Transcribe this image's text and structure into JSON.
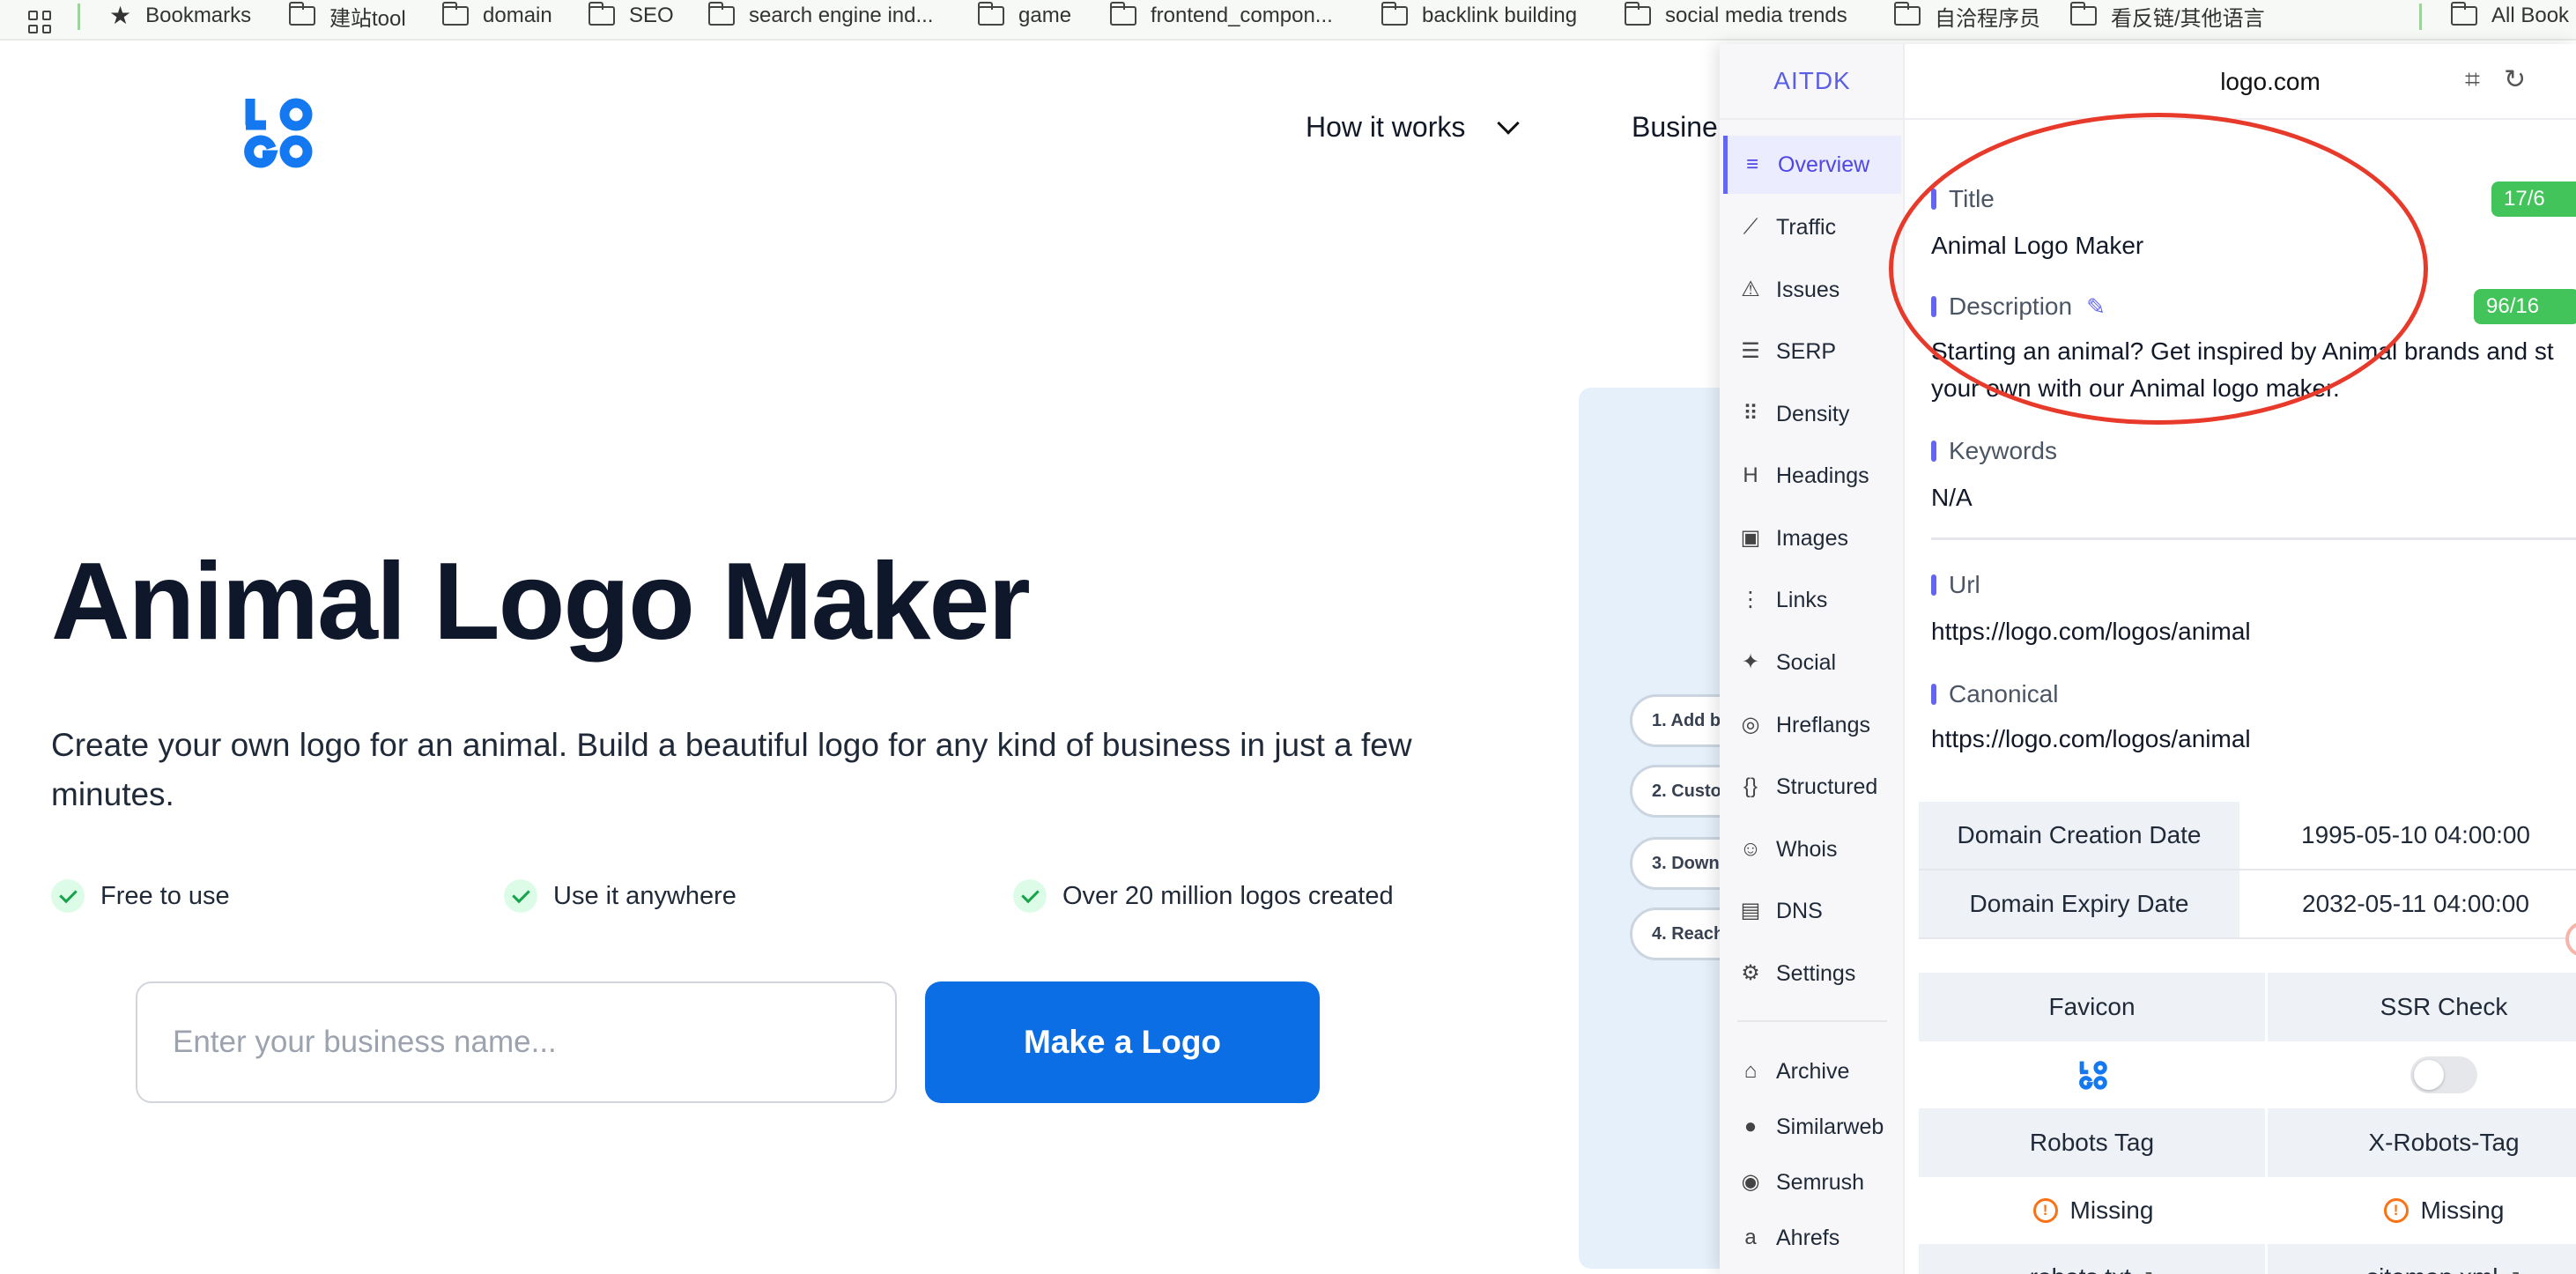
{
  "bookmarks": {
    "items": [
      {
        "label": "Bookmarks",
        "icon": "star-icon"
      },
      {
        "label": "建站tool",
        "icon": "folder-icon"
      },
      {
        "label": "domain",
        "icon": "folder-icon"
      },
      {
        "label": "SEO",
        "icon": "folder-icon"
      },
      {
        "label": "search engine ind...",
        "icon": "folder-icon"
      },
      {
        "label": "game",
        "icon": "folder-icon"
      },
      {
        "label": "frontend_compon...",
        "icon": "folder-icon"
      },
      {
        "label": "backlink building",
        "icon": "folder-icon"
      },
      {
        "label": "social media trends",
        "icon": "folder-icon"
      },
      {
        "label": "自洽程序员",
        "icon": "folder-icon"
      },
      {
        "label": "看反链/其他语言",
        "icon": "folder-icon"
      }
    ],
    "all_label": "All Book"
  },
  "site": {
    "nav": {
      "how_it_works": "How it works",
      "business": "Busine"
    },
    "hero": {
      "title": "Animal Logo Maker",
      "subtitle": "Create your own logo for an animal. Build a beautiful logo for any kind of business in just a few minutes."
    },
    "features": [
      "Free to use",
      "Use it anywhere",
      "Over 20 million logos created"
    ],
    "input_placeholder": "Enter your business name...",
    "cta": "Make a Logo",
    "steps": [
      "1. Add b",
      "2. Custo",
      "3. Downl",
      "4. Reach"
    ]
  },
  "panel": {
    "brand": "AITDK",
    "domain": "logo.com",
    "sidebar": [
      {
        "label": "Overview",
        "icon": "overview-icon",
        "active": true
      },
      {
        "label": "Traffic",
        "icon": "traffic-icon"
      },
      {
        "label": "Issues",
        "icon": "warning-icon"
      },
      {
        "label": "SERP",
        "icon": "serp-icon"
      },
      {
        "label": "Density",
        "icon": "density-icon"
      },
      {
        "label": "Headings",
        "icon": "heading-icon"
      },
      {
        "label": "Images",
        "icon": "image-icon"
      },
      {
        "label": "Links",
        "icon": "links-icon"
      },
      {
        "label": "Social",
        "icon": "twitter-icon"
      },
      {
        "label": "Hreflangs",
        "icon": "globe-icon"
      },
      {
        "label": "Structured",
        "icon": "braces-icon"
      },
      {
        "label": "Whois",
        "icon": "user-search-icon"
      },
      {
        "label": "DNS",
        "icon": "server-icon"
      },
      {
        "label": "Settings",
        "icon": "gear-icon"
      }
    ],
    "sidebar_extra": [
      {
        "label": "Archive",
        "icon": "archive-icon"
      },
      {
        "label": "Similarweb",
        "icon": "similarweb-icon"
      },
      {
        "label": "Semrush",
        "icon": "semrush-icon"
      },
      {
        "label": "Ahrefs",
        "icon": "amazon-icon"
      }
    ],
    "overview": {
      "title_label": "Title",
      "title_count": "17/6",
      "title_value": "Animal Logo Maker",
      "description_label": "Description",
      "description_count": "96/16",
      "description_line1": "Starting an animal? Get inspired by Animal brands and st",
      "description_line2": "your own with our Animal logo maker.",
      "keywords_label": "Keywords",
      "keywords_value": "N/A",
      "url_label": "Url",
      "url_value": "https://logo.com/logos/animal",
      "canonical_label": "Canonical",
      "canonical_value": "https://logo.com/logos/animal"
    },
    "domain_info": {
      "creation_label": "Domain Creation Date",
      "creation_value": "1995-05-10 04:00:00",
      "expiry_label": "Domain Expiry Date",
      "expiry_value": "2032-05-11 04:00:00"
    },
    "checks": {
      "favicon_label": "Favicon",
      "ssr_label": "SSR Check",
      "robots_tag_label": "Robots Tag",
      "x_robots_label": "X-Robots-Tag",
      "robots_tag_value": "Missing",
      "x_robots_value": "Missing",
      "robots_txt": "robots.txt",
      "sitemap": "sitemap.xml"
    }
  }
}
